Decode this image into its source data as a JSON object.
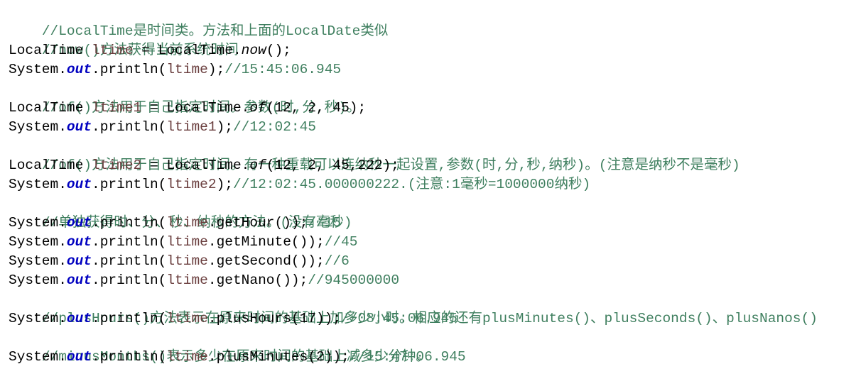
{
  "code_lines": [
    {
      "type": "comment",
      "text": "//LocalTime是时间类。方法和上面的LocalDate类似"
    },
    {
      "type": "comment",
      "text": "//now()方法获得当前系统时间"
    },
    {
      "type": "decl",
      "cls": "LocalTime ",
      "var": "ltime",
      "mid": " = LocalTime.",
      "call": "now",
      "args": "();"
    },
    {
      "type": "print",
      "pre": "System.",
      "field": "out",
      "mid": ".println(",
      "var": "ltime",
      "rest": ");",
      "comment": "//15:45:06.945"
    },
    {
      "type": "comment",
      "text": "//of()方法用于自己指定时间。参数(时,分,秒)。"
    },
    {
      "type": "decl",
      "cls": "LocalTime ",
      "var": "ltime1",
      "mid": " = LocalTime.",
      "call": "of",
      "args": "(12, 2, 45);"
    },
    {
      "type": "print",
      "pre": "System.",
      "field": "out",
      "mid": ".println(",
      "var": "ltime1",
      "rest": ");",
      "comment": "//12:02:45"
    },
    {
      "type": "comment",
      "text": "//of()方法用于自己指定时间。有一种重载可以连纳秒一起设置,参数(时,分,秒,纳秒)。(注意是纳秒不是毫秒)"
    },
    {
      "type": "decl",
      "cls": "LocalTime ",
      "var": "ltime2",
      "mid": " = LocalTime.",
      "call": "of",
      "args": "(12, 2, 45,222);"
    },
    {
      "type": "print",
      "pre": "System.",
      "field": "out",
      "mid": ".println(",
      "var": "ltime2",
      "rest": ");",
      "comment": "//12:02:45.000000222.(注意:1毫秒=1000000纳秒)"
    },
    {
      "type": "comment",
      "text": "//单独获得时、分、秒、纳秒的方法。(没有毫秒)"
    },
    {
      "type": "print",
      "pre": "System.",
      "field": "out",
      "mid": ".println(",
      "var": "ltime",
      "rest": ".getHour());",
      "comment": "//15"
    },
    {
      "type": "print",
      "pre": "System.",
      "field": "out",
      "mid": ".println(",
      "var": "ltime",
      "rest": ".getMinute());",
      "comment": "//45"
    },
    {
      "type": "print",
      "pre": "System.",
      "field": "out",
      "mid": ".println(",
      "var": "ltime",
      "rest": ".getSecond());",
      "comment": "//6"
    },
    {
      "type": "print",
      "pre": "System.",
      "field": "out",
      "mid": ".println(",
      "var": "ltime",
      "rest": ".getNano());",
      "comment": "//945000000"
    },
    {
      "type": "comment",
      "text": "//plusHours()方法表示在原来时间的基础上加多少小时。相应的还有plusMinutes()、plusSeconds()、plusNanos()"
    },
    {
      "type": "print",
      "pre": "System.",
      "field": "out",
      "mid": ".println(",
      "var": "ltime",
      "rest": ".plusHours(17));",
      "comment": "//08:45:06.945"
    },
    {
      "type": "comment",
      "text": "//minusMonths()表示多少在原来时间的基础上减多少分钟。"
    },
    {
      "type": "print",
      "pre": "System.",
      "field": "out",
      "mid": ".println(",
      "var": "ltime",
      "rest": ".plusMinutes(2));",
      "comment": "//15:47:06.945"
    }
  ]
}
